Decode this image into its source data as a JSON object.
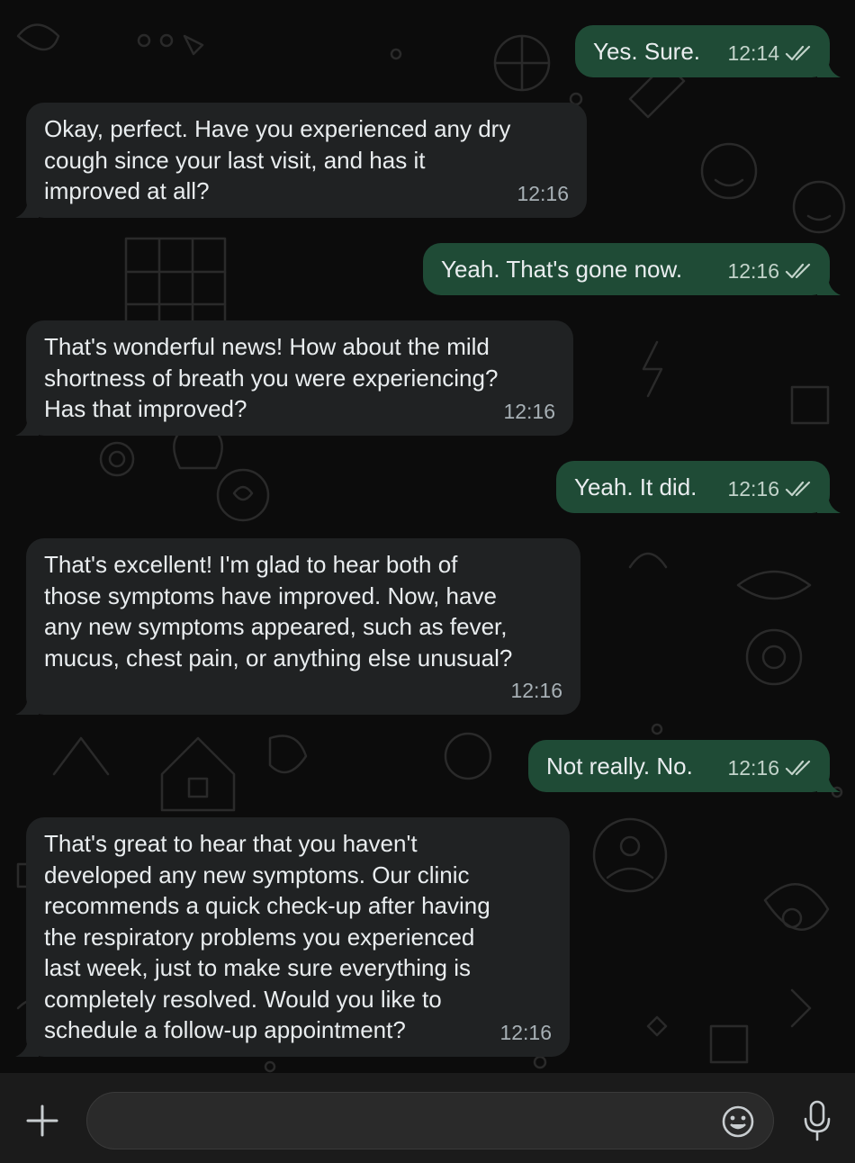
{
  "colors": {
    "app_background": "#0c0c0c",
    "incoming_bubble": "#202223",
    "outgoing_bubble": "#1f4b36",
    "text": "#e9edef",
    "timestamp": "#a7b0b5",
    "composer_background": "#1b1b1b",
    "input_background": "#2a2a2a"
  },
  "messages": [
    {
      "direction": "outgoing",
      "text": "Yes. Sure.",
      "time": "12:14",
      "status_icon": "double-check-icon"
    },
    {
      "direction": "incoming",
      "text": "Okay, perfect. Have you experienced any dry\ncough since your last visit, and has it\nimproved at all?",
      "time": "12:16"
    },
    {
      "direction": "outgoing",
      "text": "Yeah. That's gone now.",
      "time": "12:16",
      "status_icon": "double-check-icon"
    },
    {
      "direction": "incoming",
      "text": "That's wonderful news! How about the mild\nshortness of breath you were experiencing?\nHas that improved?",
      "time": "12:16"
    },
    {
      "direction": "outgoing",
      "text": "Yeah. It did.",
      "time": "12:16",
      "status_icon": "double-check-icon"
    },
    {
      "direction": "incoming",
      "text": "That's excellent! I'm glad to hear both of\nthose symptoms have improved. Now, have\nany new symptoms appeared, such as fever,\nmucus, chest pain, or anything else unusual?",
      "time": "12:16"
    },
    {
      "direction": "outgoing",
      "text": "Not really. No.",
      "time": "12:16",
      "status_icon": "double-check-icon"
    },
    {
      "direction": "incoming",
      "text": "That's great to hear that you haven't\ndeveloped any new symptoms. Our clinic\nrecommends a quick check-up after having\nthe respiratory problems you experienced\nlast week, just to make sure everything is\ncompletely resolved. Would you like to\nschedule a follow-up appointment?",
      "time": "12:16"
    }
  ],
  "composer": {
    "attach_icon": "plus-icon",
    "input_value": "",
    "input_placeholder": "",
    "emoji_icon": "emoji-icon",
    "voice_icon": "microphone-icon"
  }
}
